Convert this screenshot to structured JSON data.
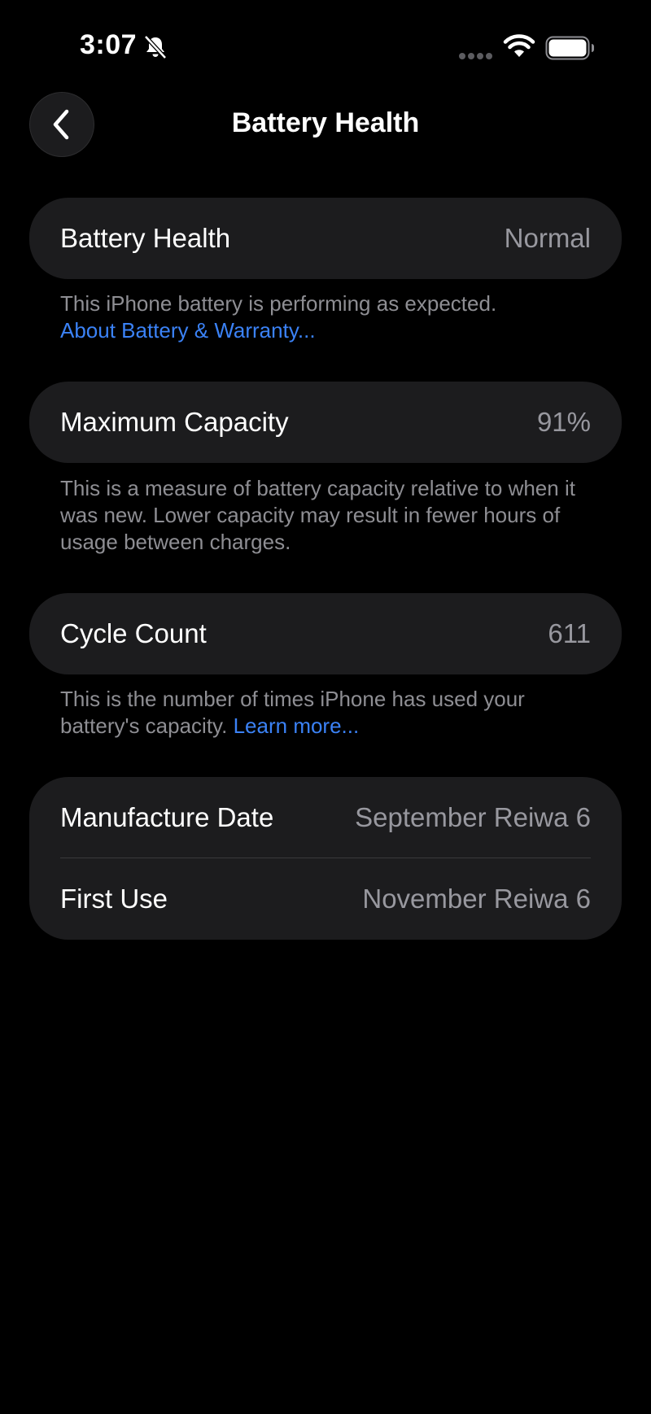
{
  "status_bar": {
    "time": "3:07",
    "icons": [
      "bell-slash-icon",
      "signal-dots-icon",
      "wifi-icon",
      "battery-icon"
    ]
  },
  "nav": {
    "title": "Battery Health",
    "back_icon": "chevron-left-icon"
  },
  "sections": {
    "battery_health": {
      "label": "Battery Health",
      "value": "Normal",
      "footnote": "This iPhone battery is performing as expected.",
      "link": "About Battery & Warranty..."
    },
    "maximum_capacity": {
      "label": "Maximum Capacity",
      "value": "91%",
      "footnote": "This is a measure of battery capacity relative to when it was new. Lower capacity may result in fewer hours of usage between charges."
    },
    "cycle_count": {
      "label": "Cycle Count",
      "value": "611",
      "footnote": "This is the number of times iPhone has used your battery's capacity.",
      "link": "Learn more..."
    },
    "dates": {
      "manufacture_label": "Manufacture Date",
      "manufacture_value": "September Reiwa 6",
      "first_use_label": "First Use",
      "first_use_value": "November Reiwa 6"
    }
  },
  "colors": {
    "background": "#000000",
    "card": "#1c1c1e",
    "secondary_text": "#98989f",
    "link": "#3b82f6"
  }
}
